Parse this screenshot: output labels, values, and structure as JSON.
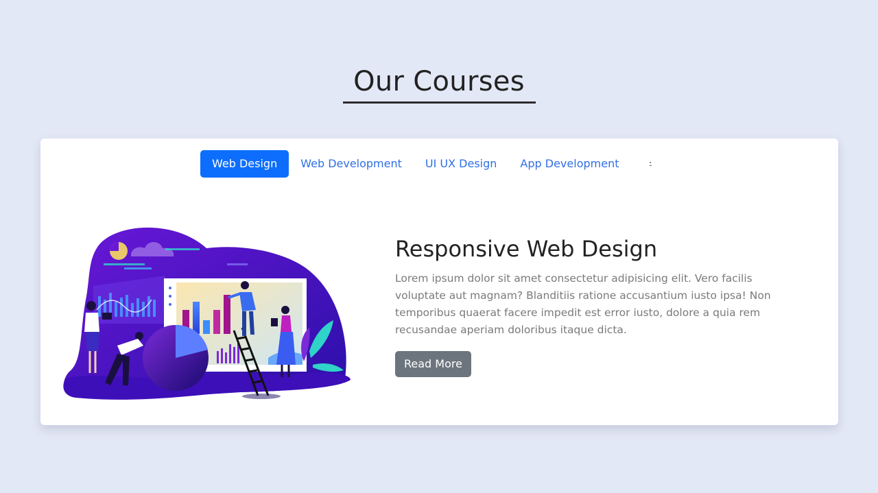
{
  "header": {
    "title": "Our Courses"
  },
  "tabs": [
    {
      "label": "Web Design",
      "active": true
    },
    {
      "label": "Web Development",
      "active": false
    },
    {
      "label": "UI UX Design",
      "active": false
    },
    {
      "label": "App Development",
      "active": false
    }
  ],
  "theme_toggle": {
    "icon": "moon-icon",
    "color": "#f2b705"
  },
  "course": {
    "title": "Responsive Web Design",
    "description": "Lorem ipsum dolor sit amet consectetur adipisicing elit. Vero facilis voluptate aut magnam? Blanditiis ratione accusantium iusto ipsa! Non temporibus quaerat facere impedit est error iusto, dolore a quia rem recusandae aperiam doloribus itaque dicta.",
    "read_more_label": "Read More",
    "illustration": "analytics-team-illustration"
  },
  "colors": {
    "background": "#e3e8f6",
    "accent": "#0d6efd",
    "button_secondary": "#6c757d",
    "illustration_primary": "#5a0fc8"
  }
}
